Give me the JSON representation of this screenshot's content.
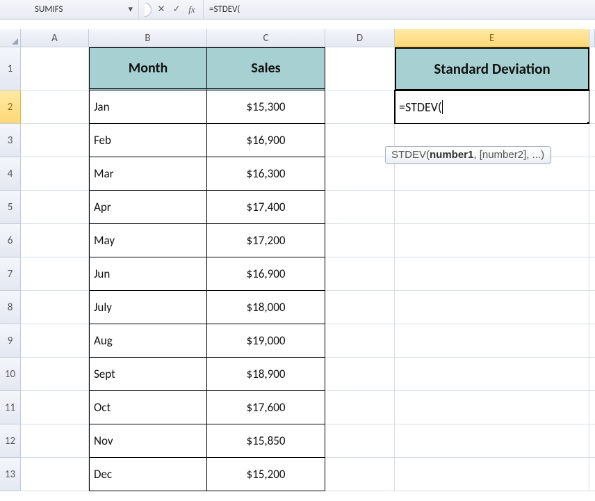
{
  "formula_bar": {
    "name_box": "SUMIFS",
    "fx_label": "fx",
    "x_glyph": "✕",
    "check_glyph": "✓",
    "arrow_glyph": "▾",
    "formula": "=STDEV("
  },
  "columns": [
    "A",
    "B",
    "C",
    "D",
    "E"
  ],
  "active_column": "E",
  "row_numbers": [
    "1",
    "2",
    "3",
    "4",
    "5",
    "6",
    "7",
    "8",
    "9",
    "10",
    "11",
    "12",
    "13"
  ],
  "active_row": "2",
  "headers": {
    "month": "Month",
    "sales": "Sales",
    "stddev": "Standard Deviation"
  },
  "editing_cell": {
    "address": "E2",
    "value": "=STDEV("
  },
  "tooltip": {
    "fn": "STDEV(",
    "arg1": "number1",
    "rest": ", [number2], ...)"
  },
  "table": [
    {
      "month": "Jan",
      "sales": "$15,300"
    },
    {
      "month": "Feb",
      "sales": "$16,900"
    },
    {
      "month": "Mar",
      "sales": "$16,300"
    },
    {
      "month": "Apr",
      "sales": "$17,400"
    },
    {
      "month": "May",
      "sales": "$17,200"
    },
    {
      "month": "Jun",
      "sales": "$16,900"
    },
    {
      "month": "July",
      "sales": "$18,000"
    },
    {
      "month": "Aug",
      "sales": "$19,000"
    },
    {
      "month": "Sept",
      "sales": "$18,900"
    },
    {
      "month": "Oct",
      "sales": "$17,600"
    },
    {
      "month": "Nov",
      "sales": "$15,850"
    },
    {
      "month": "Dec",
      "sales": "$15,200"
    }
  ]
}
